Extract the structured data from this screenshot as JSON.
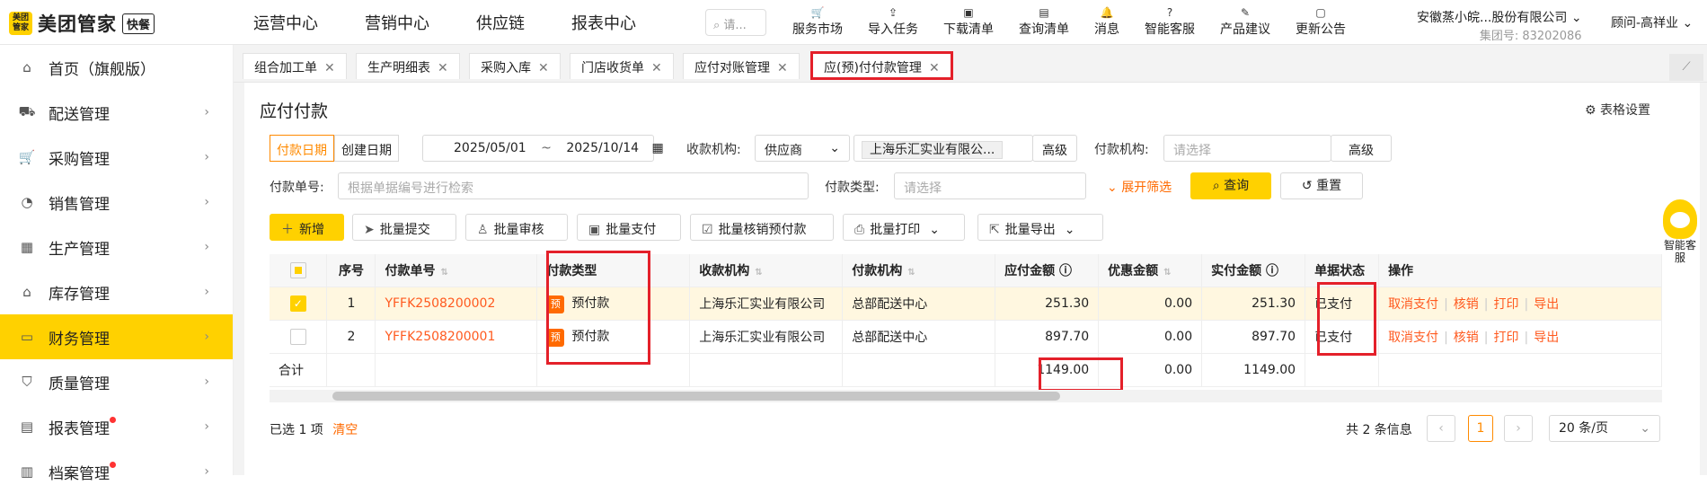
{
  "header": {
    "logo_mark": "美团\n管家",
    "logo_name": "美团管家",
    "logo_badge": "快餐",
    "nav": [
      "运营中心",
      "营销中心",
      "供应链",
      "报表中心"
    ],
    "nav_active_index": 2,
    "search_placeholder": "请...",
    "tools": [
      {
        "label": "服务市场",
        "icon": "cart-icon"
      },
      {
        "label": "导入任务",
        "icon": "import-icon"
      },
      {
        "label": "下载清单",
        "icon": "download-icon"
      },
      {
        "label": "查询清单",
        "icon": "list-icon"
      },
      {
        "label": "消息",
        "icon": "bell-icon"
      },
      {
        "label": "智能客服",
        "icon": "help-icon"
      },
      {
        "label": "产品建议",
        "icon": "feedback-icon"
      },
      {
        "label": "更新公告",
        "icon": "notice-icon"
      }
    ],
    "company": "安徽蒸小皖...股份有限公司",
    "group_no": "集团号: 83202086",
    "user": "顾问-高祥业"
  },
  "sidebar": {
    "items": [
      {
        "label": "首页（旗舰版）",
        "icon": "home-icon",
        "chevron": false
      },
      {
        "label": "配送管理",
        "icon": "truck-icon",
        "chevron": true
      },
      {
        "label": "采购管理",
        "icon": "cart-icon",
        "chevron": true
      },
      {
        "label": "销售管理",
        "icon": "buy-icon",
        "chevron": true
      },
      {
        "label": "生产管理",
        "icon": "factory-icon",
        "chevron": true
      },
      {
        "label": "库存管理",
        "icon": "warehouse-icon",
        "chevron": true
      },
      {
        "label": "财务管理",
        "icon": "wallet-icon",
        "chevron": true,
        "active": true
      },
      {
        "label": "质量管理",
        "icon": "shield-icon",
        "chevron": true
      },
      {
        "label": "报表管理",
        "icon": "report-icon",
        "chevron": true,
        "dot": true
      },
      {
        "label": "档案管理",
        "icon": "archive-icon",
        "chevron": true,
        "dot": true
      }
    ]
  },
  "tabs": [
    "组合加工单",
    "生产明细表",
    "采购入库",
    "门店收货单",
    "应付对账管理",
    "应(预)付付款管理"
  ],
  "page": {
    "title": "应付付款",
    "table_settings": "表格设置"
  },
  "filters": {
    "date_type": [
      "付款日期",
      "创建日期"
    ],
    "date_start": "2025/05/01",
    "date_sep": "~",
    "date_end": "2025/10/14",
    "payee_org_label": "收款机构:",
    "payee_org_type": "供应商",
    "payee_org_value": "上海乐汇实业有限公...",
    "advanced": "高级",
    "payer_org_label": "付款机构:",
    "payer_org_placeholder": "请选择",
    "pay_no_label": "付款单号:",
    "pay_no_placeholder": "根据单据编号进行检索",
    "pay_type_label": "付款类型:",
    "pay_type_placeholder": "请选择",
    "expand": "展开筛选",
    "query": "查询",
    "reset": "重置"
  },
  "toolbar": [
    "新增",
    "批量提交",
    "批量审核",
    "批量支付",
    "批量核销预付款",
    "批量打印",
    "批量导出"
  ],
  "table": {
    "headers": [
      "序号",
      "付款单号",
      "付款类型",
      "收款机构",
      "付款机构",
      "应付金额",
      "优惠金额",
      "实付金额",
      "单据状态",
      "操作"
    ],
    "rows": [
      {
        "no": "1",
        "code": "YFFK2508200002",
        "type": "预付款",
        "type_badge": "预",
        "payee": "上海乐汇实业有限公司",
        "payer": "总部配送中心",
        "payable": "251.30",
        "discount": "0.00",
        "paid": "251.30",
        "status": "已支付",
        "selected": true
      },
      {
        "no": "2",
        "code": "YFFK2508200001",
        "type": "预付款",
        "type_badge": "预",
        "payee": "上海乐汇实业有限公司",
        "payer": "总部配送中心",
        "payable": "897.70",
        "discount": "0.00",
        "paid": "897.70",
        "status": "已支付",
        "selected": false
      }
    ],
    "actions": [
      "取消支付",
      "核销",
      "打印",
      "导出"
    ],
    "total_label": "合计",
    "total_payable": "1149.00",
    "total_discount": "0.00",
    "total_paid": "1149.00"
  },
  "footer": {
    "selected_text": "已选 1 项",
    "clear": "清空",
    "total_info": "共 2 条信息",
    "current_page": "1",
    "page_size": "20 条/页"
  },
  "assistant": "智能客服",
  "colors": {
    "accent": "#ffd100",
    "orange": "#ff6a00",
    "highlight": "#e4202a"
  }
}
